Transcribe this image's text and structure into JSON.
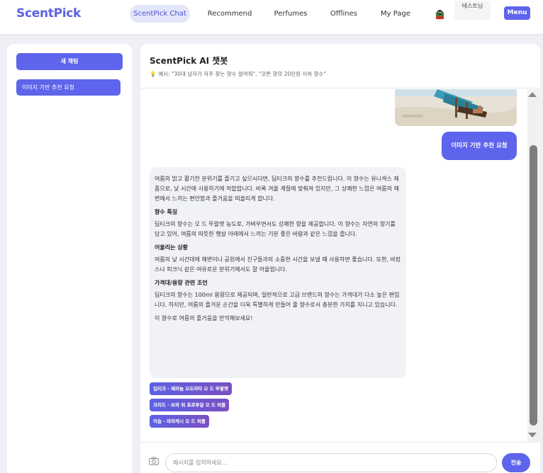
{
  "app": {
    "logo": "ScentPick"
  },
  "nav": {
    "items": [
      {
        "label": "ScentPick Chat",
        "active": true
      },
      {
        "label": "Recommend"
      },
      {
        "label": "Perfumes"
      },
      {
        "label": "Offlines"
      },
      {
        "label": "My Page"
      }
    ],
    "user_name": "테스트님",
    "menu_label": "Menu"
  },
  "sidebar": {
    "new_chat_label": "새 채팅",
    "items": [
      {
        "label": "이미지 기반 추천 요청"
      }
    ]
  },
  "chat": {
    "title": "ScentPick AI 챗봇",
    "hint": "예시: \"30대 남자가 자주 찾는 향수 알려줘\", \"코튼 향의 20만원 이하 향수\"",
    "user_message": "이미지 기반 추천 요청",
    "bot": {
      "intro": "여름의 밝고 활기찬 분위기를 즐기고 싶으시다면, 딥티크의 향수를 추천드립니다. 이 향수는 유니섹스 제품으로, 낮 시간에 사용하기에 적합합니다. 비록 겨울 계절에 맞춰져 있지만, 그 상쾌한 느낌은 여름의 해변에서 느끼는 편안함과 즐거움을 떠올리게 합니다.",
      "sections": [
        {
          "heading": "향수 특징",
          "body": "딥티크의 향수는 오 드 뚜왈렛 농도로, 가벼우면서도 상쾌한 향을 제공합니다. 이 향수는 자연의 향기를 담고 있어, 여름의 따뜻한 햇살 아래에서 느끼는 기분 좋은 바람과 같은 느낌을 줍니다."
        },
        {
          "heading": "어울리는 상황",
          "body": "여름의 낮 시간대에 해변이나 공원에서 친구들과의 소중한 시간을 보낼 때 사용하면 좋습니다. 또한, 바캉스나 피크닉 같은 여유로운 분위기에서도 잘 어울립니다."
        },
        {
          "heading": "가격대/용량 관련 조언",
          "body": "딥티크의 향수는 100ml 용량으로 제공되며, 일반적으로 고급 브랜드의 향수는 가격대가 다소 높은 편입니다. 하지만, 여름의 즐거운 순간을 더욱 특별하게 만들어 줄 향수로서 충분한 가치를 지니고 있습니다."
        }
      ],
      "outro": "이 향수로 여름의 즐거움을 만끽해보세요!"
    },
    "chips": [
      "딥티크 - 제라늄 오도라타 오 드 뚜왈렛",
      "크리드 - 브와 뒤 포르투갈 오 드 퍼퓸",
      "이솝 - 마라케시 오 드 퍼퓸"
    ],
    "input_placeholder": "메시지를 입력하세요...",
    "send_label": "전송"
  },
  "colors": {
    "accent": "#5e64eb",
    "logo": "#5b62e4"
  }
}
